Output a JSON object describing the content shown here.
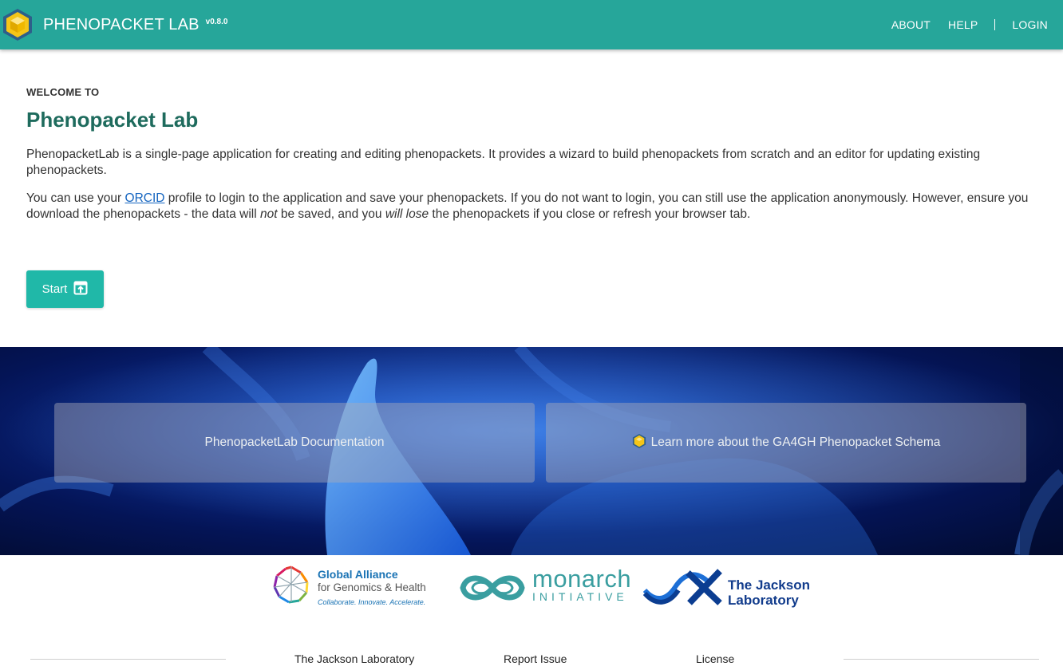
{
  "header": {
    "app_name": "PHENOPACKET LAB",
    "version": "v0.8.0",
    "nav": {
      "about": "ABOUT",
      "help": "HELP",
      "login": "LOGIN"
    }
  },
  "welcome": {
    "eyebrow": "WELCOME TO",
    "title": "Phenopacket Lab",
    "intro": "PhenopacketLab is a single-page application for creating and editing phenopackets. It provides a wizard to build phenopackets from scratch and an editor for updating existing phenopackets.",
    "login_info": {
      "pre": "You can use your ",
      "link": "ORCID",
      "mid1": " profile to login to the application and save your phenopackets. If you do not want to login, you can still use the application anonymously. However, ensure you download the phenopackets - the data will ",
      "em1": "not",
      "mid2": " be saved, and you ",
      "em2": "will lose",
      "post": " the phenopackets if you close or refresh your browser tab."
    },
    "start_button": "Start"
  },
  "banner": {
    "doc_card": "PhenopacketLab Documentation",
    "schema_card": "Learn more about the GA4GH Phenopacket Schema"
  },
  "sponsors": {
    "ga4gh": {
      "line1": "Global Alliance",
      "line2": "for Genomics & Health",
      "tagline": "Collaborate. Innovate. Accelerate."
    },
    "monarch": {
      "line1": "monarch",
      "line2": "INITIATIVE"
    },
    "jax": {
      "line1": "The Jackson",
      "line2": "Laboratory"
    }
  },
  "footer": {
    "jackson": "The Jackson Laboratory",
    "report": "Report Issue",
    "license": "License"
  },
  "colors": {
    "header_bg": "#26a69a",
    "title": "#1e6b5d",
    "start_button": "#20b8a8",
    "link": "#1565c0"
  },
  "icons": {
    "brand": "cube-logo-icon",
    "start": "open-in-new-icon",
    "schema": "cube-logo-icon"
  }
}
